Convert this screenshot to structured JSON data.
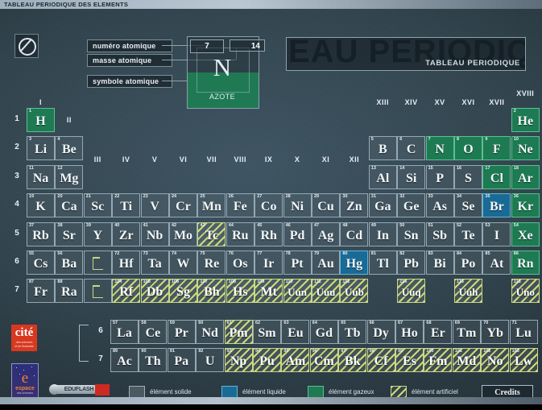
{
  "window": {
    "title": "TABLEAU PERIODIQUE DES ELEMENTS"
  },
  "banner": {
    "ghost_text": "EAU PERIODIQU",
    "label": "TABLEAU PERIODIQUE"
  },
  "callouts": {
    "atomic_number": "numéro atomique",
    "atomic_mass": "masse atomique",
    "atomic_symbol": "symbole atomique"
  },
  "example": {
    "number": "7",
    "mass": "14",
    "symbol": "N",
    "name": "AZOTE"
  },
  "legend": {
    "solid": "élément solide",
    "liquid": "élément liquide",
    "gas": "élément gazeux",
    "artificial": "élément artificiel",
    "credits": "Credits"
  },
  "colors": {
    "gas": "#1e7a52",
    "liquid": "#1a6a96",
    "artificial": "#d6e278",
    "solid": "#ffffff",
    "background": "#32454f",
    "accent_red": "#d8381f"
  },
  "logos": {
    "cite": {
      "line1": "cité",
      "line2": "des sciences",
      "line3": "et de l'industrie"
    },
    "espace": {
      "mark": "e",
      "word": "espace",
      "sub": "des sciences"
    },
    "eduflash": {
      "text": "EDUFLASH"
    }
  },
  "periods": [
    "1",
    "2",
    "3",
    "4",
    "5",
    "6",
    "7"
  ],
  "fblock_rows": [
    "6",
    "7"
  ],
  "groups": [
    {
      "label": "I",
      "col": 1,
      "row": 1
    },
    {
      "label": "II",
      "col": 2,
      "row": 1
    },
    {
      "label": "III",
      "col": 3,
      "row": 3
    },
    {
      "label": "IV",
      "col": 4,
      "row": 3
    },
    {
      "label": "V",
      "col": 5,
      "row": 3
    },
    {
      "label": "VI",
      "col": 6,
      "row": 3
    },
    {
      "label": "VII",
      "col": 7,
      "row": 3
    },
    {
      "label": "VIII",
      "col": 8,
      "row": 3
    },
    {
      "label": "IX",
      "col": 9,
      "row": 3
    },
    {
      "label": "X",
      "col": 10,
      "row": 3
    },
    {
      "label": "XI",
      "col": 11,
      "row": 3
    },
    {
      "label": "XII",
      "col": 12,
      "row": 3
    },
    {
      "label": "XIII",
      "col": 13,
      "row": 1
    },
    {
      "label": "XIV",
      "col": 14,
      "row": 1
    },
    {
      "label": "XV",
      "col": 15,
      "row": 1
    },
    {
      "label": "XVI",
      "col": 16,
      "row": 1
    },
    {
      "label": "XVII",
      "col": 17,
      "row": 1
    },
    {
      "label": "XVIII",
      "col": 18,
      "row": 0
    }
  ],
  "elements": [
    {
      "z": "1",
      "sym": "H",
      "col": 1,
      "row": 1,
      "state": "gas"
    },
    {
      "z": "2",
      "sym": "He",
      "col": 18,
      "row": 1,
      "state": "gas"
    },
    {
      "z": "3",
      "sym": "Li",
      "col": 1,
      "row": 2,
      "state": "solid"
    },
    {
      "z": "4",
      "sym": "Be",
      "col": 2,
      "row": 2,
      "state": "solid"
    },
    {
      "z": "5",
      "sym": "B",
      "col": 13,
      "row": 2,
      "state": "solid"
    },
    {
      "z": "6",
      "sym": "C",
      "col": 14,
      "row": 2,
      "state": "solid"
    },
    {
      "z": "7",
      "sym": "N",
      "col": 15,
      "row": 2,
      "state": "gas"
    },
    {
      "z": "8",
      "sym": "O",
      "col": 16,
      "row": 2,
      "state": "gas"
    },
    {
      "z": "9",
      "sym": "F",
      "col": 17,
      "row": 2,
      "state": "gas"
    },
    {
      "z": "10",
      "sym": "Ne",
      "col": 18,
      "row": 2,
      "state": "gas"
    },
    {
      "z": "11",
      "sym": "Na",
      "col": 1,
      "row": 3,
      "state": "solid"
    },
    {
      "z": "12",
      "sym": "Mg",
      "col": 2,
      "row": 3,
      "state": "solid"
    },
    {
      "z": "13",
      "sym": "Al",
      "col": 13,
      "row": 3,
      "state": "solid"
    },
    {
      "z": "14",
      "sym": "Si",
      "col": 14,
      "row": 3,
      "state": "solid"
    },
    {
      "z": "15",
      "sym": "P",
      "col": 15,
      "row": 3,
      "state": "solid"
    },
    {
      "z": "16",
      "sym": "S",
      "col": 16,
      "row": 3,
      "state": "solid"
    },
    {
      "z": "17",
      "sym": "Cl",
      "col": 17,
      "row": 3,
      "state": "gas"
    },
    {
      "z": "18",
      "sym": "Ar",
      "col": 18,
      "row": 3,
      "state": "gas"
    },
    {
      "z": "19",
      "sym": "K",
      "col": 1,
      "row": 4,
      "state": "solid"
    },
    {
      "z": "20",
      "sym": "Ca",
      "col": 2,
      "row": 4,
      "state": "solid"
    },
    {
      "z": "21",
      "sym": "Sc",
      "col": 3,
      "row": 4,
      "state": "solid"
    },
    {
      "z": "22",
      "sym": "Ti",
      "col": 4,
      "row": 4,
      "state": "solid"
    },
    {
      "z": "23",
      "sym": "V",
      "col": 5,
      "row": 4,
      "state": "solid"
    },
    {
      "z": "24",
      "sym": "Cr",
      "col": 6,
      "row": 4,
      "state": "solid"
    },
    {
      "z": "25",
      "sym": "Mn",
      "col": 7,
      "row": 4,
      "state": "solid"
    },
    {
      "z": "26",
      "sym": "Fe",
      "col": 8,
      "row": 4,
      "state": "solid"
    },
    {
      "z": "27",
      "sym": "Co",
      "col": 9,
      "row": 4,
      "state": "solid"
    },
    {
      "z": "28",
      "sym": "Ni",
      "col": 10,
      "row": 4,
      "state": "solid"
    },
    {
      "z": "29",
      "sym": "Cu",
      "col": 11,
      "row": 4,
      "state": "solid"
    },
    {
      "z": "30",
      "sym": "Zn",
      "col": 12,
      "row": 4,
      "state": "solid"
    },
    {
      "z": "31",
      "sym": "Ga",
      "col": 13,
      "row": 4,
      "state": "solid"
    },
    {
      "z": "32",
      "sym": "Ge",
      "col": 14,
      "row": 4,
      "state": "solid"
    },
    {
      "z": "33",
      "sym": "As",
      "col": 15,
      "row": 4,
      "state": "solid"
    },
    {
      "z": "34",
      "sym": "Se",
      "col": 16,
      "row": 4,
      "state": "solid"
    },
    {
      "z": "35",
      "sym": "Br",
      "col": 17,
      "row": 4,
      "state": "liquid"
    },
    {
      "z": "36",
      "sym": "Kr",
      "col": 18,
      "row": 4,
      "state": "gas"
    },
    {
      "z": "37",
      "sym": "Rb",
      "col": 1,
      "row": 5,
      "state": "solid"
    },
    {
      "z": "38",
      "sym": "Sr",
      "col": 2,
      "row": 5,
      "state": "solid"
    },
    {
      "z": "39",
      "sym": "Y",
      "col": 3,
      "row": 5,
      "state": "solid"
    },
    {
      "z": "40",
      "sym": "Zr",
      "col": 4,
      "row": 5,
      "state": "solid"
    },
    {
      "z": "41",
      "sym": "Nb",
      "col": 5,
      "row": 5,
      "state": "solid"
    },
    {
      "z": "42",
      "sym": "Mo",
      "col": 6,
      "row": 5,
      "state": "solid"
    },
    {
      "z": "43",
      "sym": "Tc",
      "col": 7,
      "row": 5,
      "state": "artificial"
    },
    {
      "z": "44",
      "sym": "Ru",
      "col": 8,
      "row": 5,
      "state": "solid"
    },
    {
      "z": "45",
      "sym": "Rh",
      "col": 9,
      "row": 5,
      "state": "solid"
    },
    {
      "z": "46",
      "sym": "Pd",
      "col": 10,
      "row": 5,
      "state": "solid"
    },
    {
      "z": "47",
      "sym": "Ag",
      "col": 11,
      "row": 5,
      "state": "solid"
    },
    {
      "z": "48",
      "sym": "Cd",
      "col": 12,
      "row": 5,
      "state": "solid"
    },
    {
      "z": "49",
      "sym": "In",
      "col": 13,
      "row": 5,
      "state": "solid"
    },
    {
      "z": "50",
      "sym": "Sn",
      "col": 14,
      "row": 5,
      "state": "solid"
    },
    {
      "z": "51",
      "sym": "Sb",
      "col": 15,
      "row": 5,
      "state": "solid"
    },
    {
      "z": "52",
      "sym": "Te",
      "col": 16,
      "row": 5,
      "state": "solid"
    },
    {
      "z": "53",
      "sym": "I",
      "col": 17,
      "row": 5,
      "state": "solid"
    },
    {
      "z": "54",
      "sym": "Xe",
      "col": 18,
      "row": 5,
      "state": "gas"
    },
    {
      "z": "55",
      "sym": "Cs",
      "col": 1,
      "row": 6,
      "state": "solid"
    },
    {
      "z": "56",
      "sym": "Ba",
      "col": 2,
      "row": 6,
      "state": "solid"
    },
    {
      "z": "72",
      "sym": "Hf",
      "col": 4,
      "row": 6,
      "state": "solid"
    },
    {
      "z": "73",
      "sym": "Ta",
      "col": 5,
      "row": 6,
      "state": "solid"
    },
    {
      "z": "74",
      "sym": "W",
      "col": 6,
      "row": 6,
      "state": "solid"
    },
    {
      "z": "75",
      "sym": "Re",
      "col": 7,
      "row": 6,
      "state": "solid"
    },
    {
      "z": "76",
      "sym": "Os",
      "col": 8,
      "row": 6,
      "state": "solid"
    },
    {
      "z": "77",
      "sym": "Ir",
      "col": 9,
      "row": 6,
      "state": "solid"
    },
    {
      "z": "78",
      "sym": "Pt",
      "col": 10,
      "row": 6,
      "state": "solid"
    },
    {
      "z": "79",
      "sym": "Au",
      "col": 11,
      "row": 6,
      "state": "solid"
    },
    {
      "z": "80",
      "sym": "Hg",
      "col": 12,
      "row": 6,
      "state": "liquid"
    },
    {
      "z": "81",
      "sym": "Tl",
      "col": 13,
      "row": 6,
      "state": "solid"
    },
    {
      "z": "82",
      "sym": "Pb",
      "col": 14,
      "row": 6,
      "state": "solid"
    },
    {
      "z": "83",
      "sym": "Bi",
      "col": 15,
      "row": 6,
      "state": "solid"
    },
    {
      "z": "84",
      "sym": "Po",
      "col": 16,
      "row": 6,
      "state": "solid"
    },
    {
      "z": "85",
      "sym": "At",
      "col": 17,
      "row": 6,
      "state": "solid"
    },
    {
      "z": "86",
      "sym": "Rn",
      "col": 18,
      "row": 6,
      "state": "gas"
    },
    {
      "z": "87",
      "sym": "Fr",
      "col": 1,
      "row": 7,
      "state": "solid"
    },
    {
      "z": "88",
      "sym": "Ra",
      "col": 2,
      "row": 7,
      "state": "solid"
    },
    {
      "z": "104",
      "sym": "Rf",
      "col": 4,
      "row": 7,
      "state": "artificial"
    },
    {
      "z": "105",
      "sym": "Db",
      "col": 5,
      "row": 7,
      "state": "artificial"
    },
    {
      "z": "106",
      "sym": "Sg",
      "col": 6,
      "row": 7,
      "state": "artificial"
    },
    {
      "z": "107",
      "sym": "Bh",
      "col": 7,
      "row": 7,
      "state": "artificial"
    },
    {
      "z": "108",
      "sym": "Hs",
      "col": 8,
      "row": 7,
      "state": "artificial"
    },
    {
      "z": "109",
      "sym": "Mt",
      "col": 9,
      "row": 7,
      "state": "artificial"
    },
    {
      "z": "110",
      "sym": "Uun",
      "col": 10,
      "row": 7,
      "state": "artificial"
    },
    {
      "z": "111",
      "sym": "Uuu",
      "col": 11,
      "row": 7,
      "state": "artificial"
    },
    {
      "z": "112",
      "sym": "Uub",
      "col": 12,
      "row": 7,
      "state": "artificial"
    },
    {
      "z": "114",
      "sym": "Uuq",
      "col": 14,
      "row": 7,
      "state": "artificial"
    },
    {
      "z": "116",
      "sym": "Uuh",
      "col": 16,
      "row": 7,
      "state": "artificial"
    },
    {
      "z": "118",
      "sym": "Uno",
      "col": 18,
      "row": 7,
      "state": "artificial"
    }
  ],
  "lanthanides": [
    {
      "z": "57",
      "sym": "La",
      "state": "solid"
    },
    {
      "z": "58",
      "sym": "Ce",
      "state": "solid"
    },
    {
      "z": "59",
      "sym": "Pr",
      "state": "solid"
    },
    {
      "z": "60",
      "sym": "Nd",
      "state": "solid"
    },
    {
      "z": "61",
      "sym": "Pm",
      "state": "artificial"
    },
    {
      "z": "62",
      "sym": "Sm",
      "state": "solid"
    },
    {
      "z": "63",
      "sym": "Eu",
      "state": "solid"
    },
    {
      "z": "64",
      "sym": "Gd",
      "state": "solid"
    },
    {
      "z": "65",
      "sym": "Tb",
      "state": "solid"
    },
    {
      "z": "66",
      "sym": "Dy",
      "state": "solid"
    },
    {
      "z": "67",
      "sym": "Ho",
      "state": "solid"
    },
    {
      "z": "68",
      "sym": "Er",
      "state": "solid"
    },
    {
      "z": "69",
      "sym": "Tm",
      "state": "solid"
    },
    {
      "z": "70",
      "sym": "Yb",
      "state": "solid"
    },
    {
      "z": "71",
      "sym": "Lu",
      "state": "solid"
    }
  ],
  "actinides": [
    {
      "z": "89",
      "sym": "Ac",
      "state": "solid"
    },
    {
      "z": "90",
      "sym": "Th",
      "state": "solid"
    },
    {
      "z": "91",
      "sym": "Pa",
      "state": "solid"
    },
    {
      "z": "92",
      "sym": "U",
      "state": "solid"
    },
    {
      "z": "93",
      "sym": "Np",
      "state": "artificial"
    },
    {
      "z": "94",
      "sym": "Pu",
      "state": "artificial"
    },
    {
      "z": "95",
      "sym": "Am",
      "state": "artificial"
    },
    {
      "z": "96",
      "sym": "Cm",
      "state": "artificial"
    },
    {
      "z": "97",
      "sym": "Bk",
      "state": "artificial"
    },
    {
      "z": "98",
      "sym": "Cf",
      "state": "artificial"
    },
    {
      "z": "99",
      "sym": "Es",
      "state": "artificial"
    },
    {
      "z": "100",
      "sym": "Fm",
      "state": "artificial"
    },
    {
      "z": "101",
      "sym": "Md",
      "state": "artificial"
    },
    {
      "z": "102",
      "sym": "No",
      "state": "artificial"
    },
    {
      "z": "103",
      "sym": "Lw",
      "state": "artificial"
    }
  ]
}
